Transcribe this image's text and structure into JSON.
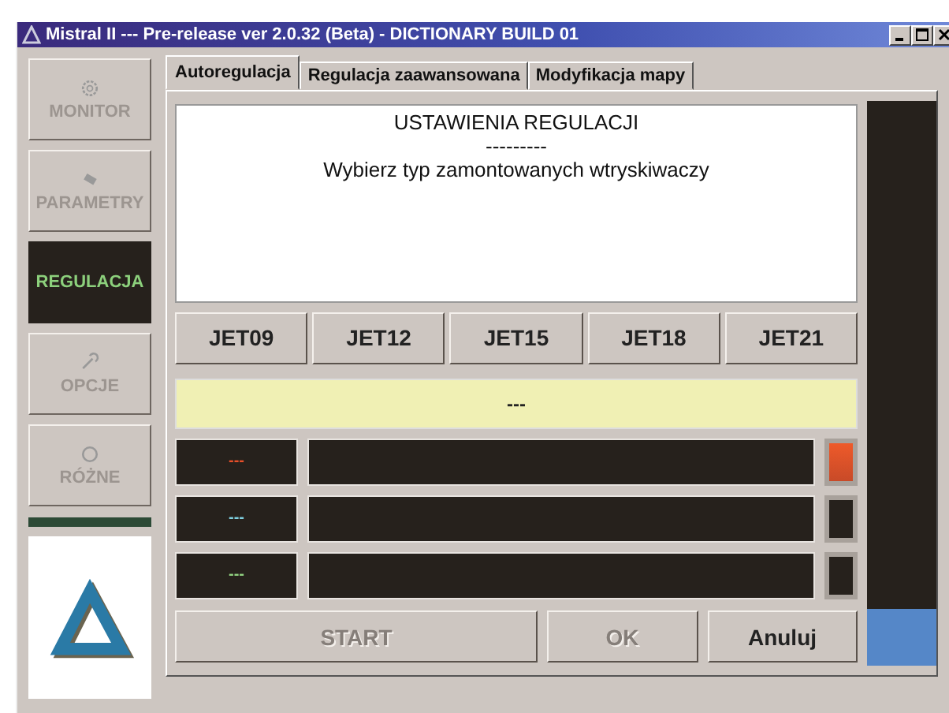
{
  "window": {
    "title": "Mistral II --- Pre-release ver 2.0.32 (Beta) - DICTIONARY BUILD 01"
  },
  "sidebar": {
    "items": [
      {
        "label": "MONITOR",
        "selected": false
      },
      {
        "label": "PARAMETRY",
        "selected": false
      },
      {
        "label": "REGULACJA",
        "selected": true
      },
      {
        "label": "OPCJE",
        "selected": false
      },
      {
        "label": "RÓŻNE",
        "selected": false
      }
    ]
  },
  "tabs": [
    {
      "label": "Autoregulacja",
      "selected": true
    },
    {
      "label": "Regulacja zaawansowana",
      "selected": false
    },
    {
      "label": "Modyfikacja mapy",
      "selected": false
    }
  ],
  "message": [
    "USTAWIENIA REGULACJI",
    "---------",
    "Wybierz typ zamontowanych wtryskiwaczy"
  ],
  "injectors": [
    "JET09",
    "JET12",
    "JET15",
    "JET18",
    "JET21"
  ],
  "status": "---",
  "channels": [
    {
      "reading": "---",
      "color": "#e8502a",
      "active": true
    },
    {
      "reading": "---",
      "color": "#7fd0e0",
      "active": false
    },
    {
      "reading": "---",
      "color": "#90d080",
      "active": false
    }
  ],
  "meter": {
    "level": 0.1
  },
  "buttons": [
    {
      "label": "START",
      "disabled": true
    },
    {
      "label": "OK",
      "disabled": true
    },
    {
      "label": "Anuluj",
      "disabled": false
    }
  ]
}
